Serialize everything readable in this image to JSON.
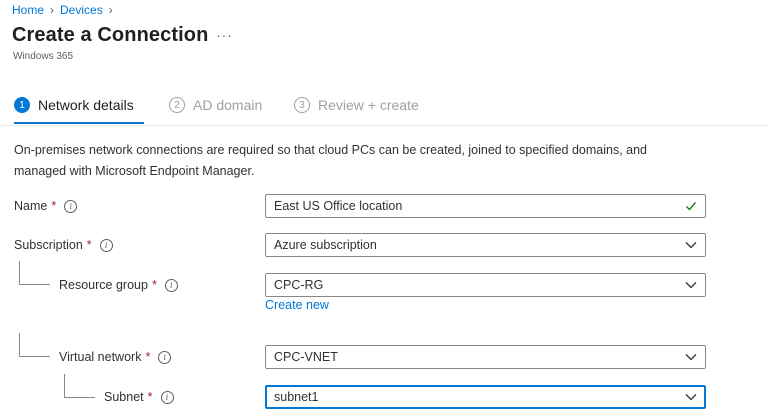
{
  "breadcrumb": {
    "items": [
      "Home",
      "Devices"
    ]
  },
  "header": {
    "title": "Create a Connection",
    "more": "···",
    "subtitle": "Windows 365"
  },
  "steps": [
    {
      "num": "1",
      "label": "Network details",
      "state": "active"
    },
    {
      "num": "2",
      "label": "AD domain",
      "state": "inactive"
    },
    {
      "num": "3",
      "label": "Review + create",
      "state": "inactive"
    }
  ],
  "description": "On-premises network connections are required so that cloud PCs can be created, joined to specified domains, and managed with Microsoft Endpoint Manager.",
  "form": {
    "name": {
      "label": "Name",
      "required": "*",
      "value": "East US Office location"
    },
    "subscription": {
      "label": "Subscription",
      "required": "*",
      "value": "Azure subscription"
    },
    "resource_group": {
      "label": "Resource group",
      "required": "*",
      "value": "CPC-RG",
      "link": "Create new"
    },
    "virtual_network": {
      "label": "Virtual network",
      "required": "*",
      "value": "CPC-VNET"
    },
    "subnet": {
      "label": "Subnet",
      "required": "*",
      "value": "subnet1"
    }
  },
  "icons": {
    "info": "info-icon",
    "chevron": "chevron-down-icon",
    "check": "checkmark-icon"
  },
  "colors": {
    "accent": "#0078d4",
    "required": "#a4262c",
    "valid": "#107c10"
  }
}
